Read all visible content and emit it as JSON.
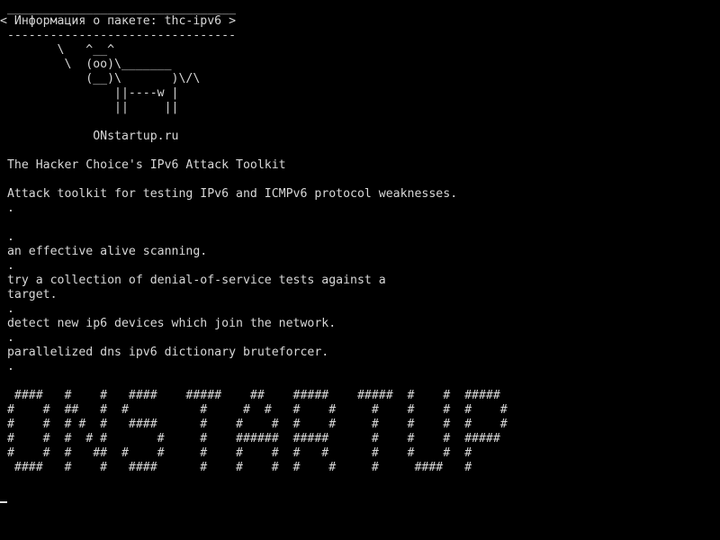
{
  "terminal": {
    "colors": {
      "background": "#000000",
      "foreground": "#d8d8d8"
    },
    "cowsay": {
      "border_top": " ________________________________",
      "title": "< Информация о пакете: thc-ipv6 >",
      "border_bottom": " --------------------------------",
      "cow": [
        "        \\   ^__^",
        "         \\  (oo)\\_______",
        "            (__)\\       )\\/\\",
        "                ||----w |",
        "                ||     ||"
      ],
      "signature": "             ONstartup.ru"
    },
    "description": [
      " The Hacker Choice's IPv6 Attack Toolkit",
      "",
      " Attack toolkit for testing IPv6 and ICMPv6 protocol weaknesses.",
      " .",
      "",
      " .",
      " an effective alive scanning.",
      " .",
      " try a collection of denial-of-service tests against a",
      " target.",
      " .",
      " detect new ip6 devices which join the network.",
      " .",
      " parallelized dns ipv6 dictionary bruteforcer.",
      " ."
    ],
    "banner": [
      "  ####   #    #   ####    #####    ##    #####    #####  #    #  #####",
      " #    #  ##   #  #          #     #  #   #    #     #    #    #  #    #",
      " #    #  # #  #   ####      #    #    #  #    #     #    #    #  #    #",
      " #    #  #  # #       #     #    ######  #####      #    #    #  #####",
      " #    #  #   ##  #    #     #    #    #  #   #      #    #    #  #",
      "  ####   #    #   ####      #    #    #  #    #     #     ####   #"
    ]
  }
}
